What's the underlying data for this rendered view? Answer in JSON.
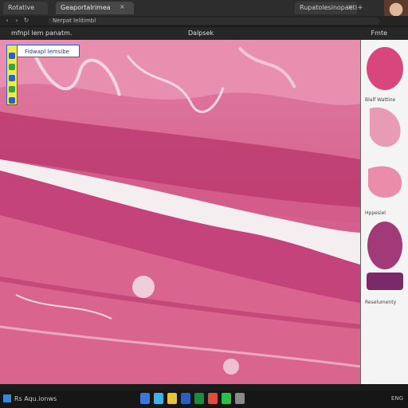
{
  "browser": {
    "tabs": [
      {
        "label": "Rotative"
      },
      {
        "label": "Geaportalrimea"
      },
      {
        "label": "Rupatolesinopaetingse"
      }
    ],
    "address": "Nerpat lelitimbl",
    "window_buttons": [
      "minimize",
      "maximize",
      "close"
    ]
  },
  "viewer": {
    "left_title": "mfnpl lem panatm.",
    "center_title": "Dalpsek",
    "right_title": "Fmte",
    "overlay_label": "Fidwapl lemsibe"
  },
  "sidebar": {
    "thumbnails": [
      {
        "label": "",
        "color": "#d8477b"
      },
      {
        "label": "Blalf Wattine",
        "color": "#e79bb5"
      },
      {
        "label": "",
        "color": "#ec8cab"
      },
      {
        "label": "Hppesiel",
        "color": "#a23a79"
      },
      {
        "label": "Reselumenty",
        "color": "#ffffff"
      }
    ]
  },
  "taskbar": {
    "status_text": "Rs Aqu.ionws",
    "icons": [
      {
        "name": "files-icon",
        "color": "#3c76d9"
      },
      {
        "name": "edge-icon",
        "color": "#3fb2e8"
      },
      {
        "name": "explorer-icon",
        "color": "#e5c43a"
      },
      {
        "name": "word-icon",
        "color": "#2b5fbb"
      },
      {
        "name": "excel-icon",
        "color": "#1f8a3f"
      },
      {
        "name": "chrome-icon",
        "color": "#e04d3c"
      },
      {
        "name": "green-app-icon",
        "color": "#2bbf4c"
      },
      {
        "name": "settings-icon",
        "color": "#8a8a8a"
      }
    ],
    "tray": "ENG"
  },
  "colors": {
    "tissue_main": "#d9648e",
    "tissue_dark": "#b8346b",
    "tissue_light": "#f2c6d6",
    "accent_blue": "#2a62c9"
  }
}
